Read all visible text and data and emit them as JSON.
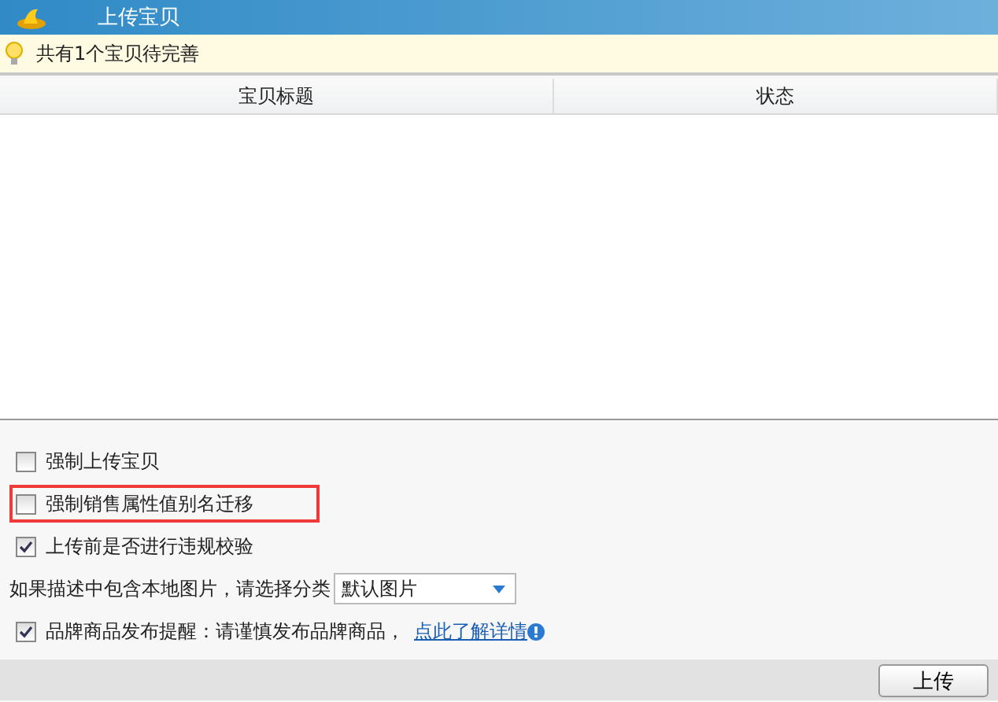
{
  "window": {
    "title": "上传宝贝"
  },
  "notice": "共有1个宝贝待完善",
  "table": {
    "columns": [
      "宝贝标题",
      "状态"
    ]
  },
  "options": [
    {
      "kind": "checkbox",
      "label": "强制上传宝贝",
      "checked": false,
      "highlighted": false
    },
    {
      "kind": "checkbox",
      "label": "强制销售属性值别名迁移",
      "checked": false,
      "highlighted": true
    },
    {
      "kind": "checkbox",
      "label": "上传前是否进行违规校验",
      "checked": true,
      "highlighted": false
    },
    {
      "kind": "select",
      "label": "如果描述中包含本地图片，请选择分类",
      "value": "默认图片",
      "highlighted": false
    },
    {
      "kind": "checkbox",
      "label": "品牌商品发布提醒：请谨慎发布品牌商品，",
      "link": "点此了解详情",
      "checked": true,
      "highlighted": false
    }
  ],
  "buttons": [
    "上传"
  ]
}
